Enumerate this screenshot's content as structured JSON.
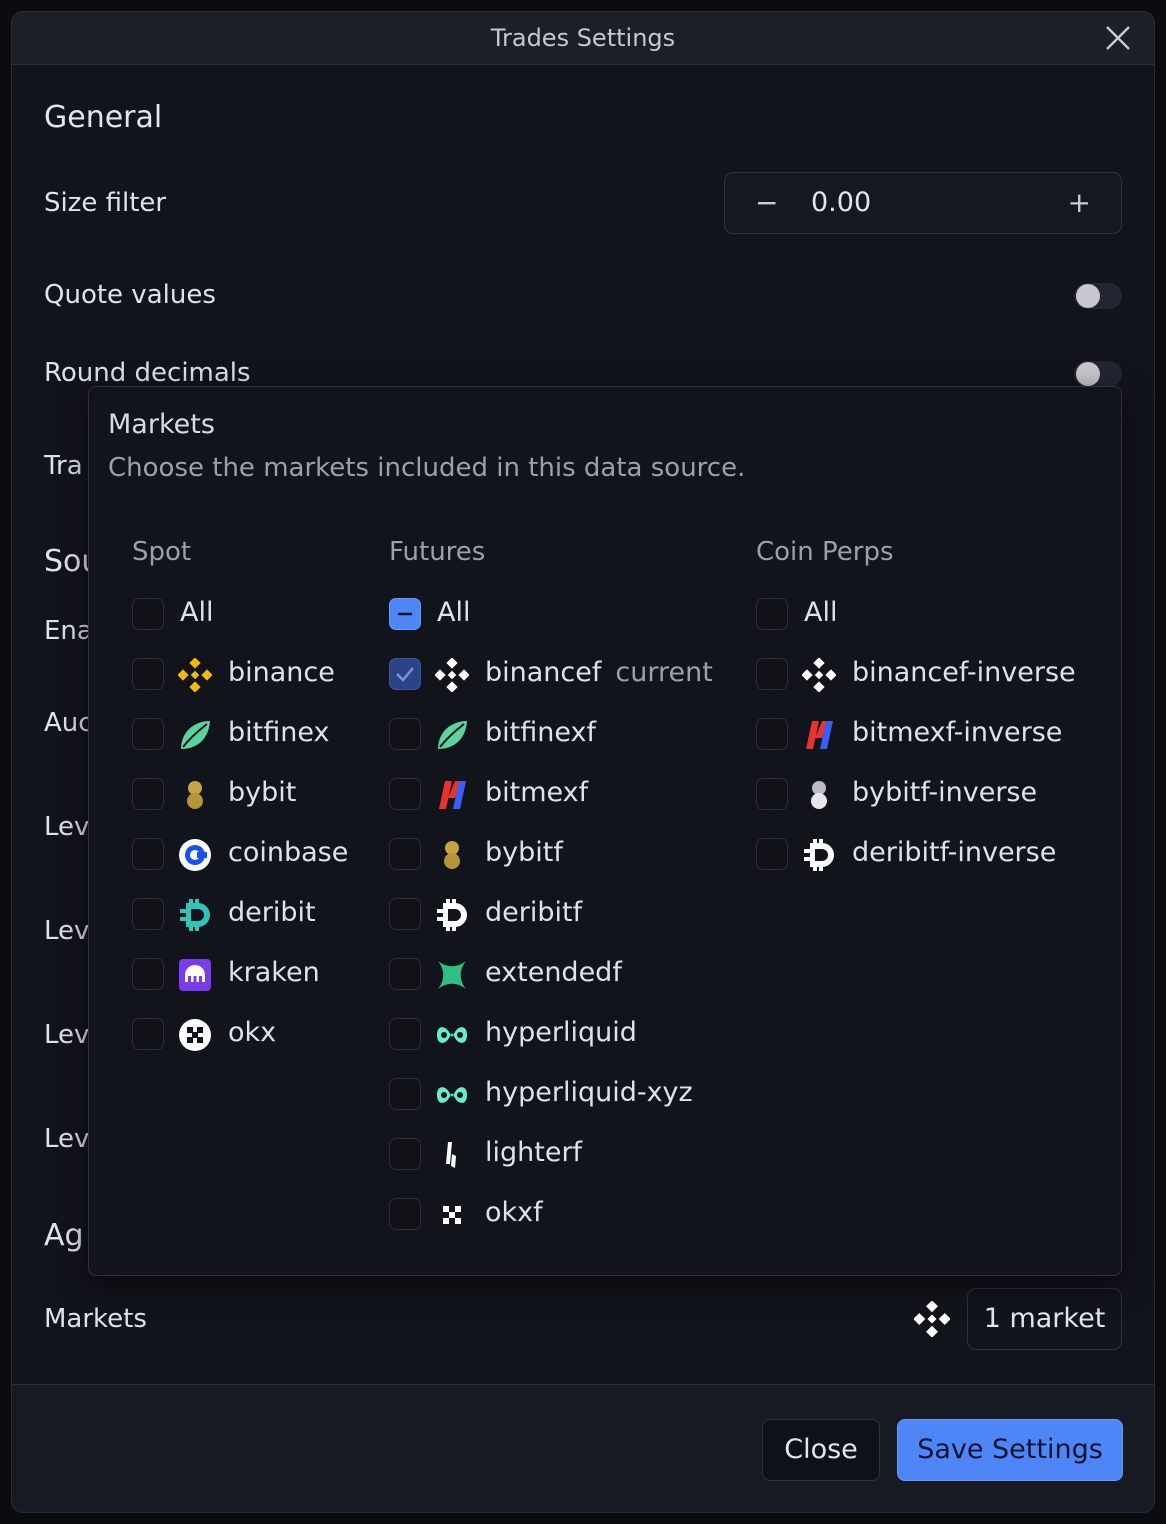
{
  "window": {
    "title": "Trades Settings"
  },
  "general": {
    "heading": "General",
    "size_filter": {
      "label": "Size filter",
      "value": "0.00",
      "minus": "−",
      "plus": "+"
    },
    "quote_values": {
      "label": "Quote values",
      "on": false
    },
    "round_decimals": {
      "label": "Round decimals",
      "on": false
    }
  },
  "partial_labels": {
    "tra": "Tra",
    "sou": "Sou",
    "ena": "Ena",
    "auc": "Auc",
    "lev1": "Lev",
    "lev2": "Lev",
    "lev3": "Lev",
    "lev4": "Lev",
    "ag": "Ag"
  },
  "markets_row": {
    "label": "Markets",
    "count": "1 market",
    "icon": "binance-icon"
  },
  "popup": {
    "title": "Markets",
    "subtitle": "Choose the markets included in this data source.",
    "columns": {
      "spot": {
        "heading": "Spot",
        "all_label": "All",
        "items": [
          {
            "name": "binance",
            "icon": "binance-icon"
          },
          {
            "name": "bitfinex",
            "icon": "bitfinex-icon"
          },
          {
            "name": "bybit",
            "icon": "bybit-icon"
          },
          {
            "name": "coinbase",
            "icon": "coinbase-icon"
          },
          {
            "name": "deribit",
            "icon": "deribit-icon"
          },
          {
            "name": "kraken",
            "icon": "kraken-icon"
          },
          {
            "name": "okx",
            "icon": "okx-icon"
          }
        ]
      },
      "futures": {
        "heading": "Futures",
        "all_label": "All",
        "items": [
          {
            "name": "binancef",
            "icon": "binance-icon",
            "checked": true,
            "tag": "current"
          },
          {
            "name": "bitfinexf",
            "icon": "bitfinex-icon"
          },
          {
            "name": "bitmexf",
            "icon": "bitmex-icon"
          },
          {
            "name": "bybitf",
            "icon": "bybit-icon"
          },
          {
            "name": "deribitf",
            "icon": "deribit-icon"
          },
          {
            "name": "extendedf",
            "icon": "extended-icon"
          },
          {
            "name": "hyperliquid",
            "icon": "hyperliquid-icon"
          },
          {
            "name": "hyperliquid-xyz",
            "icon": "hyperliquid-icon"
          },
          {
            "name": "lighterf",
            "icon": "lighter-icon"
          },
          {
            "name": "okxf",
            "icon": "okx-icon"
          }
        ]
      },
      "coin_perps": {
        "heading": "Coin Perps",
        "all_label": "All",
        "items": [
          {
            "name": "binancef-inverse",
            "icon": "binance-icon"
          },
          {
            "name": "bitmexf-inverse",
            "icon": "bitmex-icon"
          },
          {
            "name": "bybitf-inverse",
            "icon": "bybit-icon"
          },
          {
            "name": "deribitf-inverse",
            "icon": "deribit-icon"
          }
        ]
      }
    }
  },
  "footer": {
    "close_label": "Close",
    "save_label": "Save Settings"
  },
  "colors": {
    "accent": "#4f86f7",
    "background": "#12141c",
    "panel": "#1c1f28"
  }
}
